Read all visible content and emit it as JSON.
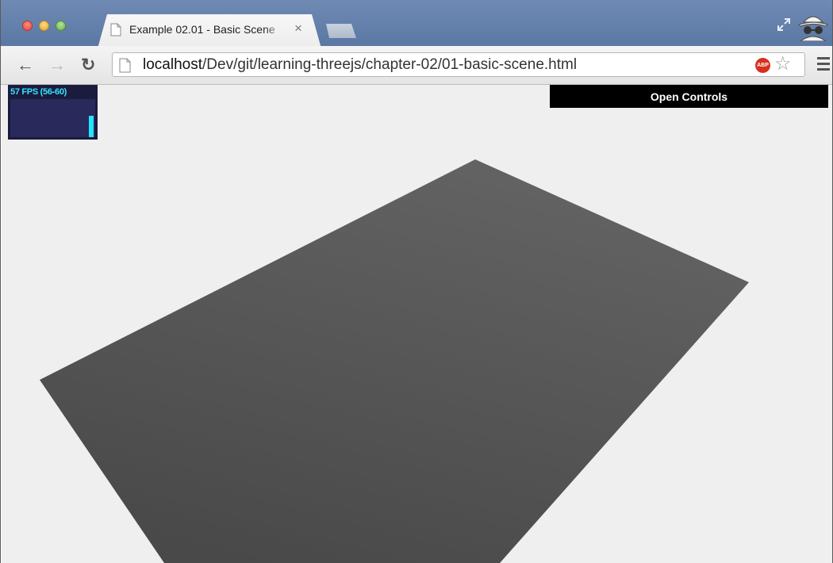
{
  "browser": {
    "tab_title": "Example 02.01 - Basic Scene",
    "tab_close_glyph": "×",
    "url_host": "localhost",
    "url_path": "/Dev/git/learning-threejs/chapter-02/01-basic-scene.html",
    "adblock_badge": "ABP",
    "icons": [
      "close-window-icon",
      "minimize-window-icon",
      "zoom-window-icon",
      "document-icon",
      "fullscreen-icon",
      "incognito-icon",
      "back-arrow-icon",
      "forward-arrow-icon",
      "reload-icon",
      "adblock-icon",
      "star-icon",
      "menu-icon"
    ]
  },
  "stats": {
    "fps_label": "57 FPS (56-60)",
    "fps_value": 57,
    "fps_min": 56,
    "fps_max": 60
  },
  "controls": {
    "toggle_label": "Open Controls"
  },
  "scene": {
    "background_color": "#efefef",
    "plane_color": "#555555"
  }
}
